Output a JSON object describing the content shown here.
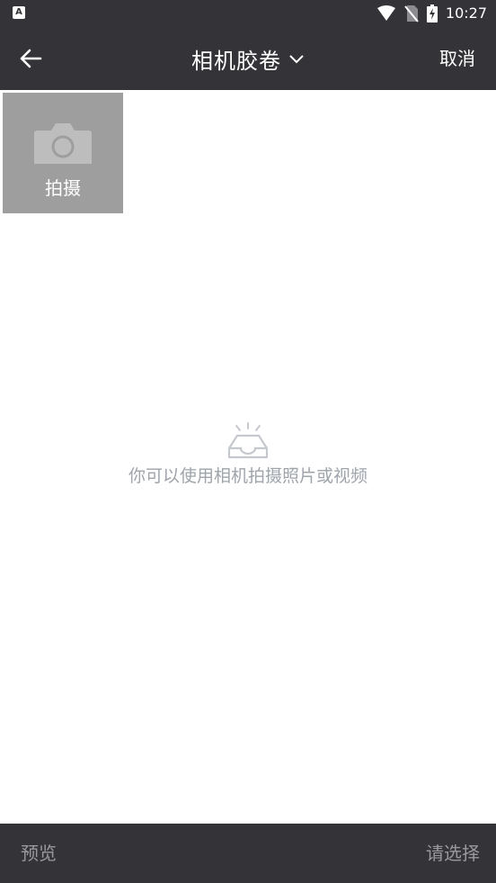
{
  "status_bar": {
    "app_icon_letter": "A",
    "time": "10:27",
    "icons": [
      "wifi-icon",
      "no-sim-icon",
      "battery-charging-icon"
    ]
  },
  "header": {
    "title": "相机胶卷",
    "cancel_label": "取消",
    "icons": [
      "back-arrow-icon",
      "chevron-down-icon"
    ]
  },
  "capture_tile": {
    "label": "拍摄",
    "icon": "camera-icon"
  },
  "empty_state": {
    "message": "你可以使用相机拍摄照片或视频",
    "icon": "empty-tray-icon"
  },
  "footer": {
    "preview_label": "预览",
    "select_label": "请选择"
  },
  "colors": {
    "bar_background": "#343438",
    "tile_background": "#9e9e9e",
    "muted_text": "#9a9a9d",
    "empty_text": "#9fa4ab"
  }
}
